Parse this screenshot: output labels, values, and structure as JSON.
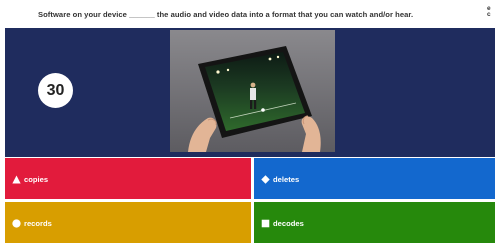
{
  "question": {
    "text": "Software on your device ______ the audio and video data into a format that you can watch and/or hear.",
    "corner_text": "e c"
  },
  "timer": {
    "value": "30"
  },
  "media": {
    "icon": "tablet-football-image"
  },
  "answers": [
    {
      "label": "copies",
      "shape": "triangle-icon",
      "color": "#e21b3c"
    },
    {
      "label": "deletes",
      "shape": "diamond-icon",
      "color": "#1368ce"
    },
    {
      "label": "records",
      "shape": "circle-icon",
      "color": "#d89e00"
    },
    {
      "label": "decodes",
      "shape": "square-icon",
      "color": "#26890c"
    }
  ],
  "colors": {
    "stage_background": "#1f2c5e",
    "page_background": "#ffffff"
  }
}
